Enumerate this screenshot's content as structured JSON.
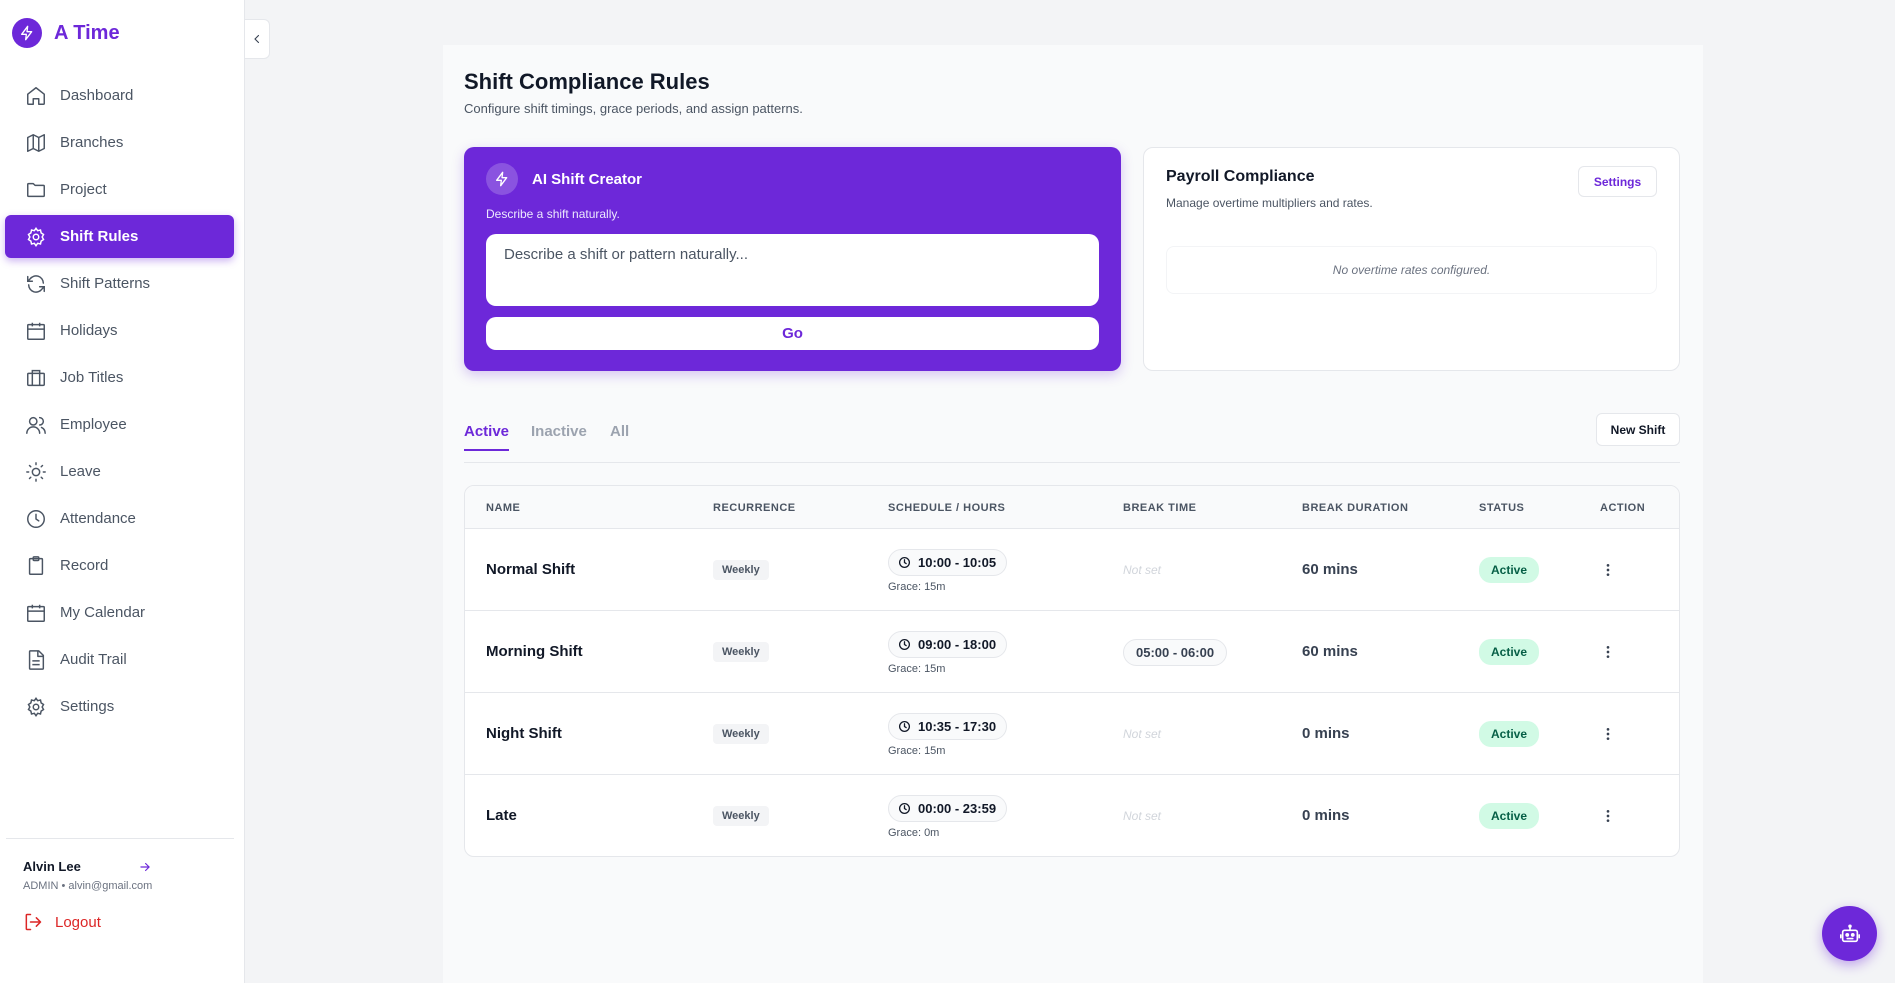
{
  "app": {
    "title": "A Time",
    "accent": "#6d28d9"
  },
  "sidebar": {
    "items": [
      {
        "label": "Dashboard",
        "icon": "home-icon"
      },
      {
        "label": "Branches",
        "icon": "map-icon"
      },
      {
        "label": "Project",
        "icon": "folder-icon"
      },
      {
        "label": "Shift Rules",
        "icon": "gear-icon",
        "active": true
      },
      {
        "label": "Shift Patterns",
        "icon": "refresh-icon"
      },
      {
        "label": "Holidays",
        "icon": "calendar-icon"
      },
      {
        "label": "Job Titles",
        "icon": "briefcase-icon"
      },
      {
        "label": "Employee",
        "icon": "users-icon"
      },
      {
        "label": "Leave",
        "icon": "sun-icon"
      },
      {
        "label": "Attendance",
        "icon": "clock-icon"
      },
      {
        "label": "Record",
        "icon": "clipboard-icon"
      },
      {
        "label": "My Calendar",
        "icon": "calendar-icon"
      },
      {
        "label": "Audit Trail",
        "icon": "file-text-icon"
      },
      {
        "label": "Settings",
        "icon": "gear-icon"
      }
    ]
  },
  "user": {
    "name": "Alvin Lee",
    "subtitle": "ADMIN • alvin@gmail.com",
    "logout_label": "Logout"
  },
  "page": {
    "title": "Shift Compliance Rules",
    "subtitle": "Configure shift timings, grace periods, and assign patterns."
  },
  "ai_creator": {
    "title": "AI Shift Creator",
    "description": "Describe a shift naturally.",
    "placeholder": "Describe a shift or pattern naturally...",
    "go_label": "Go"
  },
  "payroll": {
    "title": "Payroll Compliance",
    "subtitle": "Manage overtime multipliers and rates.",
    "settings_label": "Settings",
    "empty_text": "No overtime rates configured."
  },
  "tabs": {
    "active": "Active",
    "inactive": "Inactive",
    "all": "All",
    "new_shift_label": "New Shift"
  },
  "table": {
    "headers": {
      "name": "NAME",
      "recurrence": "RECURRENCE",
      "schedule": "SCHEDULE / HOURS",
      "break_time": "BREAK TIME",
      "break_duration": "BREAK DURATION",
      "status": "STATUS",
      "action": "ACTION"
    },
    "rows": [
      {
        "name": "Normal Shift",
        "recurrence": "Weekly",
        "schedule": "10:00 - 10:05",
        "grace": "Grace: 15m",
        "break_time": "Not set",
        "break_duration": "60 mins",
        "status": "Active"
      },
      {
        "name": "Morning Shift",
        "recurrence": "Weekly",
        "schedule": "09:00 - 18:00",
        "grace": "Grace: 15m",
        "break_time": "05:00 - 06:00",
        "break_duration": "60 mins",
        "status": "Active"
      },
      {
        "name": "Night Shift",
        "recurrence": "Weekly",
        "schedule": "10:35 - 17:30",
        "grace": "Grace: 15m",
        "break_time": "Not set",
        "break_duration": "0 mins",
        "status": "Active"
      },
      {
        "name": "Late",
        "recurrence": "Weekly",
        "schedule": "00:00 - 23:59",
        "grace": "Grace: 0m",
        "break_time": "Not set",
        "break_duration": "0 mins",
        "status": "Active"
      }
    ]
  },
  "colors": {
    "accent": "#6d28d9",
    "status_active_bg": "#d1fae5",
    "status_active_text": "#065f46",
    "logout": "#dc2626"
  }
}
